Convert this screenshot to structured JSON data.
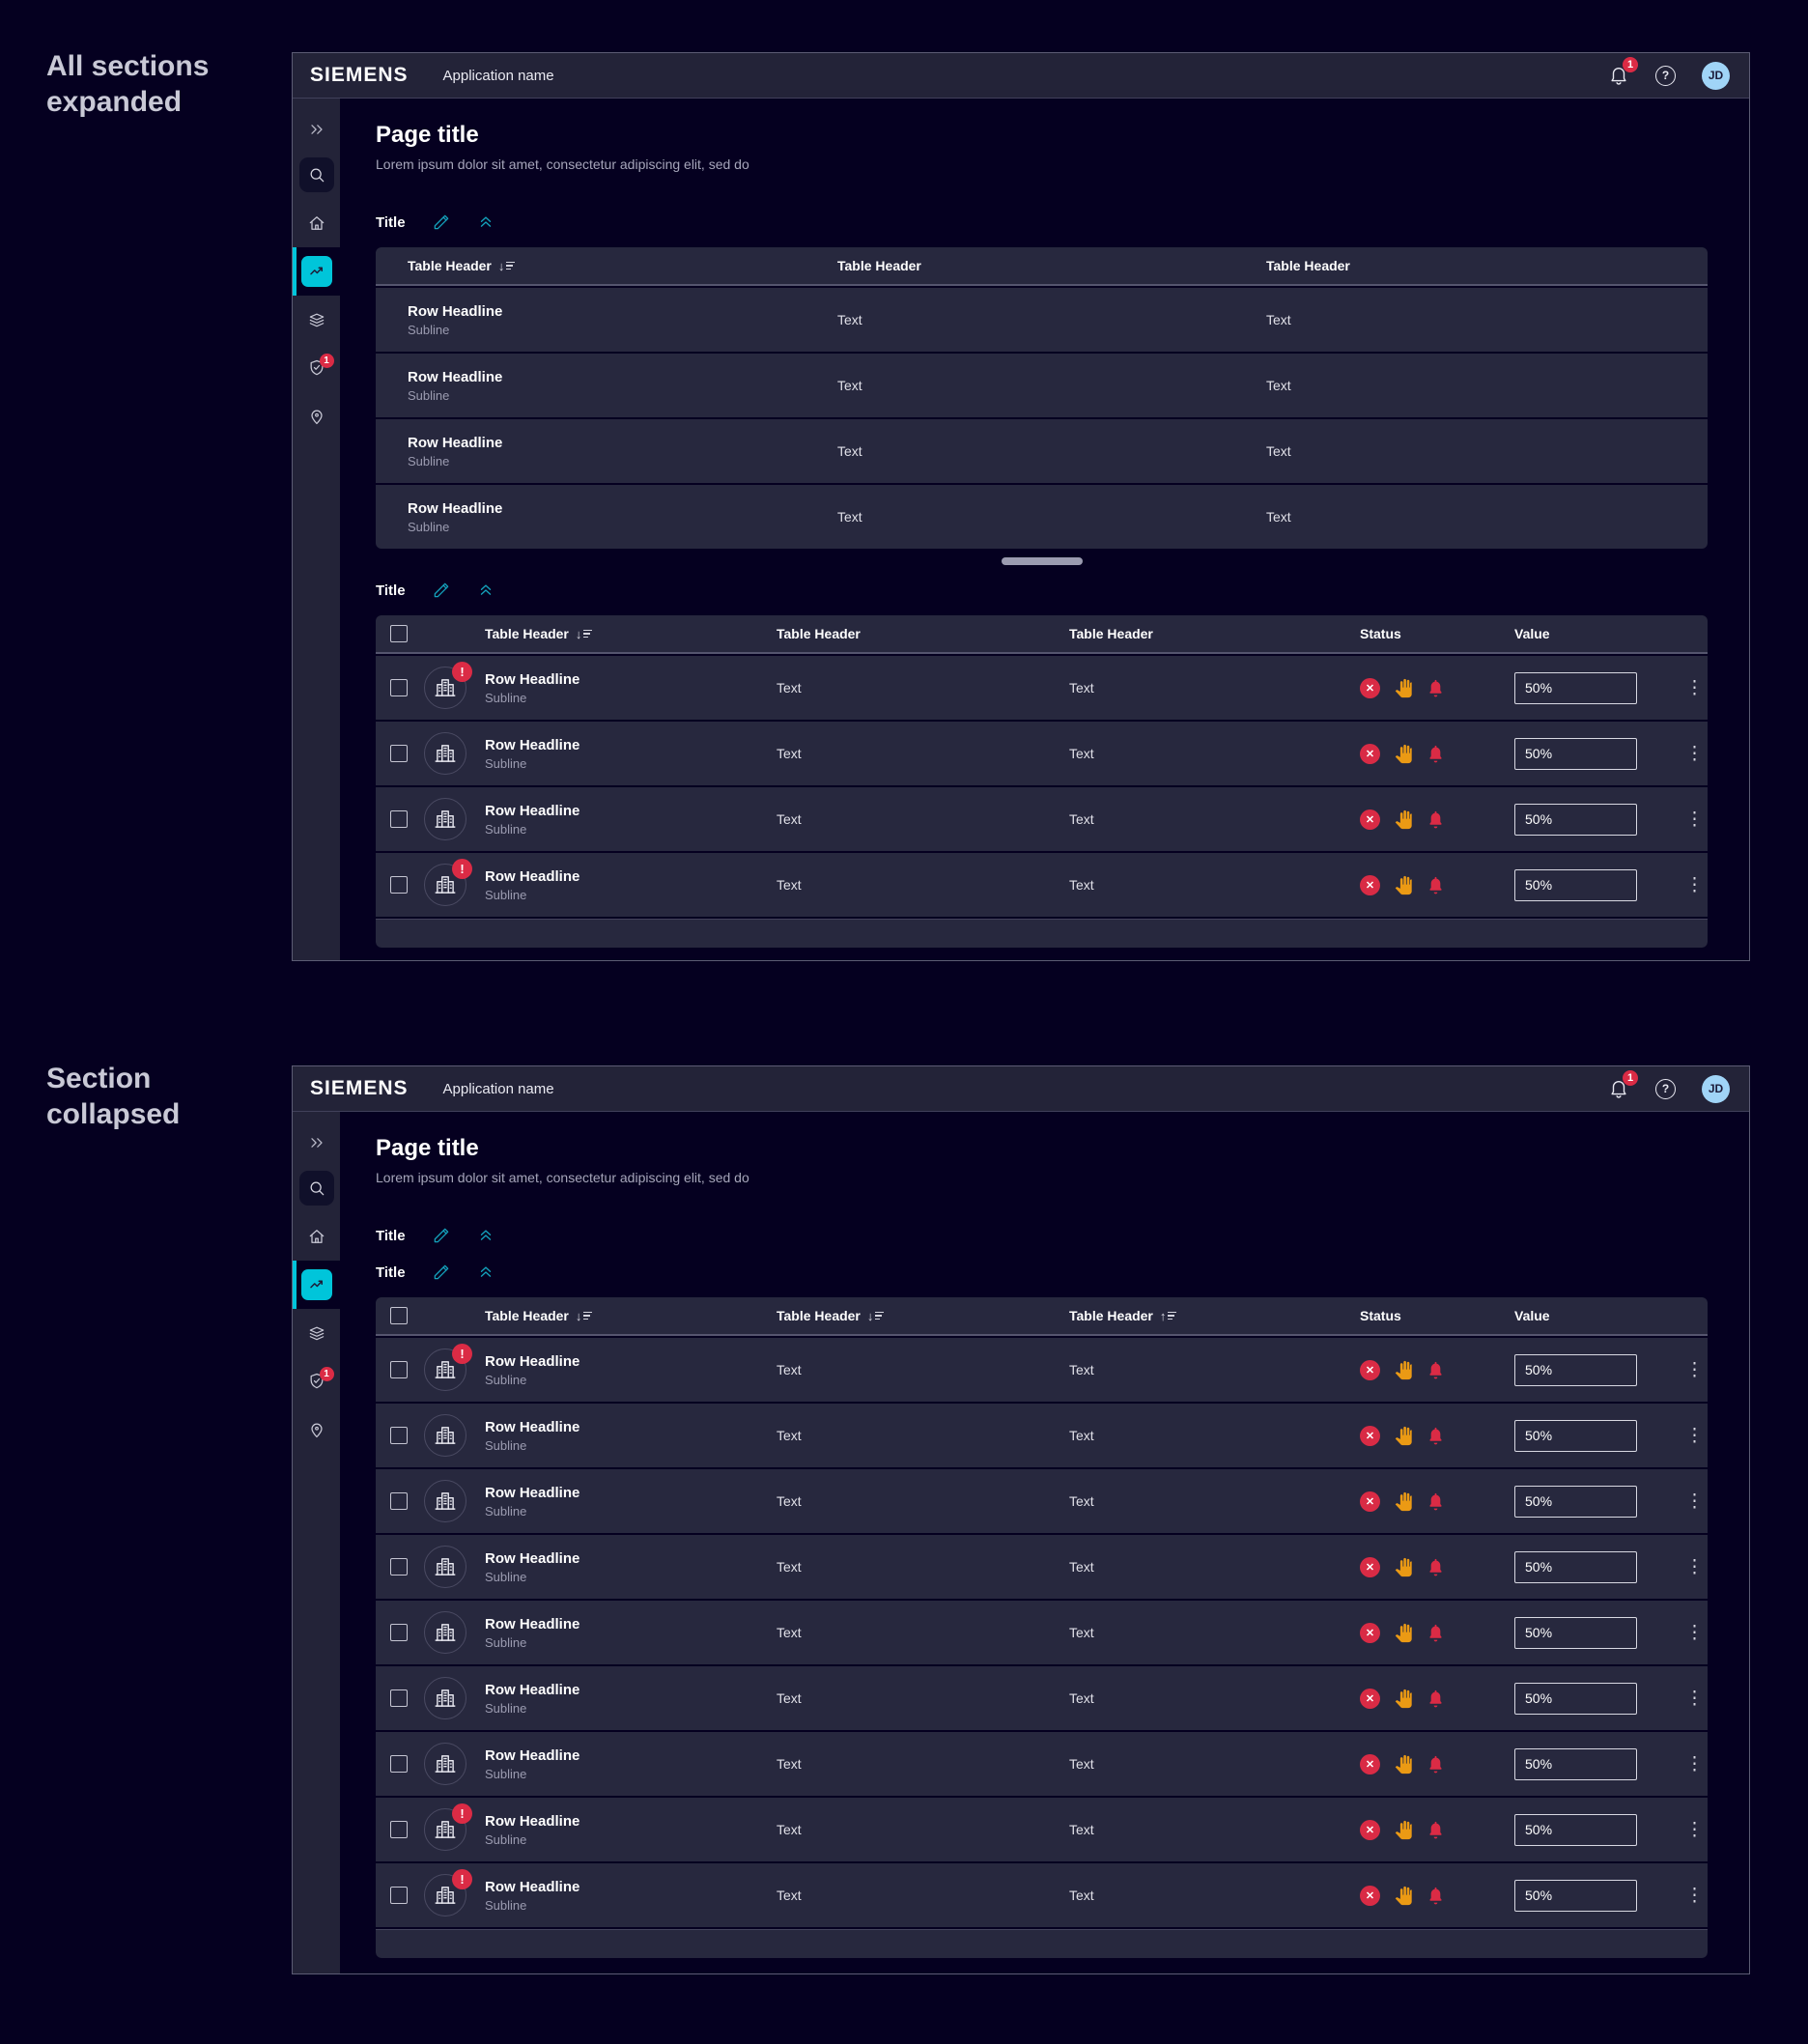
{
  "labels": {
    "first": "All sections expanded",
    "second": "Section collapsed"
  },
  "colors": {
    "accent_teal": "#14a3bd",
    "active_cyan": "#00c5da",
    "alert_red": "#db2b45",
    "warning_orange": "#eb9a14",
    "avatar_blue": "#a0d4f7",
    "row_bg": "#27283e",
    "topbar_bg": "#232338",
    "page_bg": "#050020"
  },
  "windows": [
    {
      "topbar": {
        "brand": "SIEMENS",
        "app_name": "Application name",
        "notification_count": "1",
        "help_label": "?",
        "avatar_initials": "JD"
      },
      "sidebar": {
        "icons": [
          "expand-panel",
          "search",
          "home",
          "line-chart",
          "layers",
          "shield-check",
          "location-pin"
        ],
        "active_icon": "line-chart",
        "shield_badge": "1"
      },
      "page": {
        "title": "Page title",
        "subtitle": "Lorem ipsum dolor sit amet, consectetur adipiscing elit, sed do"
      },
      "sections": [
        {
          "title": "Title",
          "table": {
            "headers": [
              {
                "label": "Table Header",
                "sort": "↓"
              },
              {
                "label": "Table Header",
                "sort": ""
              },
              {
                "label": "Table Header",
                "sort": ""
              }
            ],
            "rows": [
              {
                "headline": "Row Headline",
                "subline": "Subline",
                "col2": "Text",
                "col3": "Text"
              },
              {
                "headline": "Row Headline",
                "subline": "Subline",
                "col2": "Text",
                "col3": "Text"
              },
              {
                "headline": "Row Headline",
                "subline": "Subline",
                "col2": "Text",
                "col3": "Text"
              },
              {
                "headline": "Row Headline",
                "subline": "Subline",
                "col2": "Text",
                "col3": "Text"
              }
            ]
          }
        },
        {
          "title": "Title",
          "table": {
            "headers": [
              {
                "label": "Table Header",
                "sort": "↓"
              },
              {
                "label": "Table Header",
                "sort": ""
              },
              {
                "label": "Table Header",
                "sort": ""
              },
              {
                "label": "Status",
                "sort": ""
              },
              {
                "label": "Value",
                "sort": ""
              }
            ],
            "rows": [
              {
                "headline": "Row Headline",
                "subline": "Subline",
                "col2": "Text",
                "col3": "Text",
                "value": "50%",
                "alert": true
              },
              {
                "headline": "Row Headline",
                "subline": "Subline",
                "col2": "Text",
                "col3": "Text",
                "value": "50%",
                "alert": false
              },
              {
                "headline": "Row Headline",
                "subline": "Subline",
                "col2": "Text",
                "col3": "Text",
                "value": "50%",
                "alert": false
              },
              {
                "headline": "Row Headline",
                "subline": "Subline",
                "col2": "Text",
                "col3": "Text",
                "value": "50%",
                "alert": true
              }
            ]
          }
        }
      ]
    },
    {
      "topbar": {
        "brand": "SIEMENS",
        "app_name": "Application name",
        "notification_count": "1",
        "help_label": "?",
        "avatar_initials": "JD"
      },
      "sidebar": {
        "icons": [
          "expand-panel",
          "search",
          "home",
          "line-chart",
          "layers",
          "shield-check",
          "location-pin"
        ],
        "active_icon": "line-chart",
        "shield_badge": "1"
      },
      "page": {
        "title": "Page title",
        "subtitle": "Lorem ipsum dolor sit amet, consectetur adipiscing elit, sed do"
      },
      "sections": [
        {
          "title": "Title",
          "collapsed": true
        },
        {
          "title": "Title",
          "table": {
            "headers": [
              {
                "label": "Table Header",
                "sort": "↓"
              },
              {
                "label": "Table Header",
                "sort": "↓"
              },
              {
                "label": "Table Header",
                "sort": "↑"
              },
              {
                "label": "Status",
                "sort": ""
              },
              {
                "label": "Value",
                "sort": ""
              }
            ],
            "rows": [
              {
                "headline": "Row Headline",
                "subline": "Subline",
                "col2": "Text",
                "col3": "Text",
                "value": "50%",
                "alert": true
              },
              {
                "headline": "Row Headline",
                "subline": "Subline",
                "col2": "Text",
                "col3": "Text",
                "value": "50%",
                "alert": false
              },
              {
                "headline": "Row Headline",
                "subline": "Subline",
                "col2": "Text",
                "col3": "Text",
                "value": "50%",
                "alert": false
              },
              {
                "headline": "Row Headline",
                "subline": "Subline",
                "col2": "Text",
                "col3": "Text",
                "value": "50%",
                "alert": false
              },
              {
                "headline": "Row Headline",
                "subline": "Subline",
                "col2": "Text",
                "col3": "Text",
                "value": "50%",
                "alert": false
              },
              {
                "headline": "Row Headline",
                "subline": "Subline",
                "col2": "Text",
                "col3": "Text",
                "value": "50%",
                "alert": false
              },
              {
                "headline": "Row Headline",
                "subline": "Subline",
                "col2": "Text",
                "col3": "Text",
                "value": "50%",
                "alert": false
              },
              {
                "headline": "Row Headline",
                "subline": "Subline",
                "col2": "Text",
                "col3": "Text",
                "value": "50%",
                "alert": true
              },
              {
                "headline": "Row Headline",
                "subline": "Subline",
                "col2": "Text",
                "col3": "Text",
                "value": "50%",
                "alert": true
              }
            ]
          }
        }
      ]
    }
  ]
}
